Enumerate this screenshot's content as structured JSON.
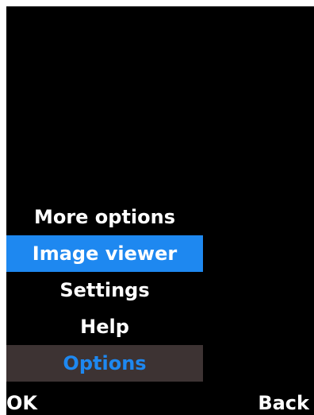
{
  "menu": {
    "items": [
      {
        "label": "More options"
      },
      {
        "label": "Image viewer",
        "selected": true
      },
      {
        "label": "Settings"
      },
      {
        "label": "Help"
      }
    ],
    "title": "Options"
  },
  "softkeys": {
    "left": "OK",
    "right": "Back"
  },
  "colors": {
    "background": "#000000",
    "highlight": "#1e88f0",
    "title_bar": "#3d3333",
    "text": "#ffffff"
  }
}
